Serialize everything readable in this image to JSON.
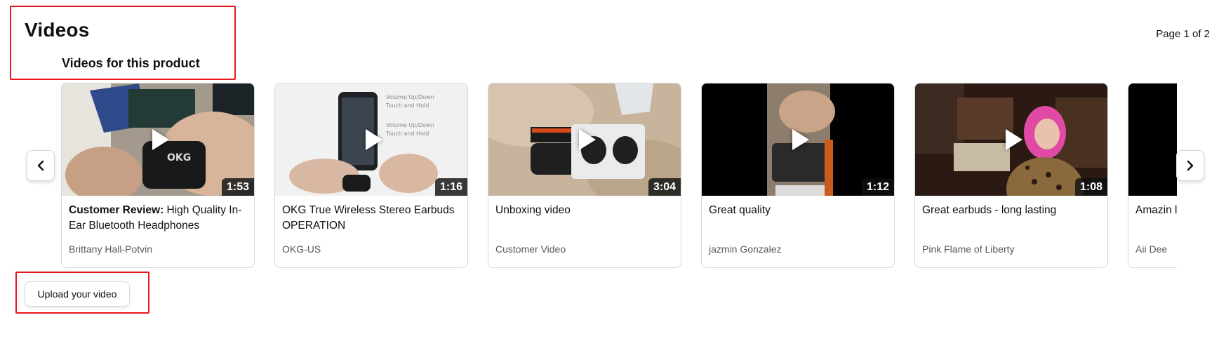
{
  "section": {
    "title": "Videos",
    "subtitle": "Videos for this product",
    "page_indicator": "Page 1 of 2"
  },
  "carousel": {
    "prev_icon": "chevron-left-icon",
    "next_icon": "chevron-right-icon",
    "videos": [
      {
        "title_prefix": "Customer Review:",
        "title": "High Quality In-Ear Bluetooth Headphones",
        "author": "Brittany Hall-Potvin",
        "duration": "1:53"
      },
      {
        "title_prefix": "",
        "title": "OKG True Wireless Stereo Earbuds OPERATION",
        "author": "OKG-US",
        "duration": "1:16"
      },
      {
        "title_prefix": "",
        "title": "Unboxing video",
        "author": "Customer Video",
        "duration": "3:04"
      },
      {
        "title_prefix": "",
        "title": "Great quality",
        "author": "jazmin Gonzalez",
        "duration": "1:12"
      },
      {
        "title_prefix": "",
        "title": "Great earbuds - long lasting",
        "author": "Pink Flame of Liberty",
        "duration": "1:08"
      },
      {
        "title_prefix": "",
        "title": "Amazin look lik",
        "author": "Aii Dee",
        "duration": ""
      }
    ]
  },
  "upload": {
    "label": "Upload your video"
  },
  "colors": {
    "highlight": "#e8161e",
    "border": "#d5d9d9",
    "muted_text": "#565959"
  }
}
